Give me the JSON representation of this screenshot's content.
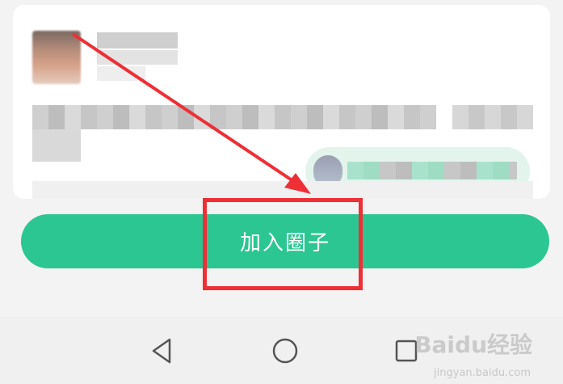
{
  "post": {
    "avatar": "user-avatar-blurred",
    "circle_icon": "circle-avatar-blurred"
  },
  "join_button": {
    "label": "加入圈子"
  },
  "nav": {
    "back_icon": "back-triangle-icon",
    "home_icon": "home-circle-icon",
    "recent_icon": "recent-square-icon"
  },
  "watermark": {
    "brand": "Baidu经验",
    "site": "jingyan.baidu.com"
  },
  "colors": {
    "button_green": "#2cc692",
    "annotation_red": "#ee2f36",
    "pill_bg": "#e2f4ec"
  }
}
